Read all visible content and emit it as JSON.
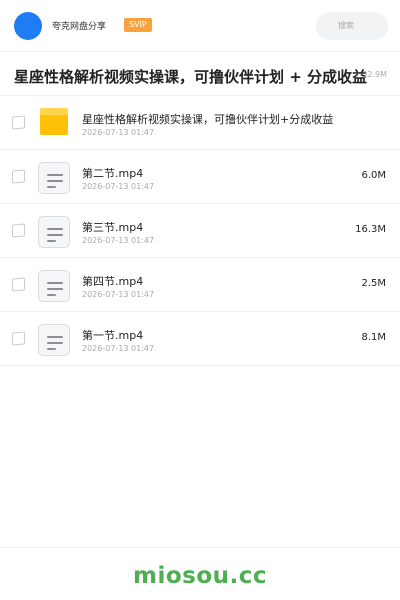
{
  "header": {
    "app_name": "夸克网盘分享",
    "badge": "SVIP",
    "search_placeholder": "搜索",
    "avatar_color": "#1f7cf5",
    "badge_color": "#f7a23b"
  },
  "share": {
    "title": "星座性格解析视频实操课，可撸伙伴计划 + 分成收益",
    "total_size": "32.9M"
  },
  "files": [
    {
      "type": "folder",
      "icon": "folder-icon",
      "name": "星座性格解析视频实操课，可撸伙伴计划+分成收益",
      "date": "2026-07-13 01:47",
      "size": ""
    },
    {
      "type": "video",
      "icon": "file-icon",
      "name": "第二节.mp4",
      "date": "2026-07-13 01:47",
      "size": "6.0M"
    },
    {
      "type": "video",
      "icon": "file-icon",
      "name": "第三节.mp4",
      "date": "2026-07-13 01:47",
      "size": "16.3M"
    },
    {
      "type": "video",
      "icon": "file-icon",
      "name": "第四节.mp4",
      "date": "2026-07-13 01:47",
      "size": "2.5M"
    },
    {
      "type": "video",
      "icon": "file-icon",
      "name": "第一节.mp4",
      "date": "2026-07-13 01:47",
      "size": "8.1M"
    }
  ],
  "footer": {
    "watermark": "miosou.cc",
    "watermark_color": "#4caf50"
  }
}
